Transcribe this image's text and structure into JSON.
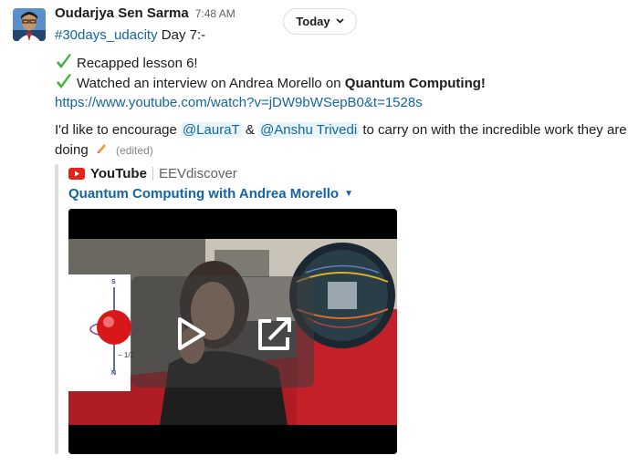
{
  "message": {
    "author": "Oudarjya Sen Sarma",
    "timestamp": "7:48 AM",
    "date_divider": "Today",
    "hashtag": "#30days_udacity",
    "day_label": "Day 7:-",
    "check_line_1": "Recapped lesson 6!",
    "check_line_2_prefix": "Watched an interview on Andrea Morello on ",
    "check_line_2_bold": "Quantum Computing!",
    "url": "https://www.youtube.com/watch?v=jDW9bWSepB0&t=1528s",
    "encourage_prefix": "I'd like to encourage ",
    "mention_1": "@LauraT",
    "amp": "&",
    "mention_2": "@Anshu Trivedi",
    "encourage_suffix": " to carry on with the incredible work they are",
    "encourage_line2": "doing",
    "edited_label": "(edited)"
  },
  "attachment": {
    "service": "YouTube",
    "channel": "EEVdiscover",
    "title": "Quantum Computing with Andrea Morello",
    "thumbnail_axis_top": "S",
    "thumbnail_axis_bottom": "N",
    "thumbnail_fraction": "− 1/2"
  },
  "colors": {
    "link": "#1264a3",
    "check": "#3cb43c",
    "youtube_red": "#e62117"
  },
  "icons": [
    "avatar",
    "check-icon",
    "pencil-emoji-icon",
    "youtube-icon",
    "play-icon",
    "open-external-icon",
    "chevron-down-icon"
  ]
}
